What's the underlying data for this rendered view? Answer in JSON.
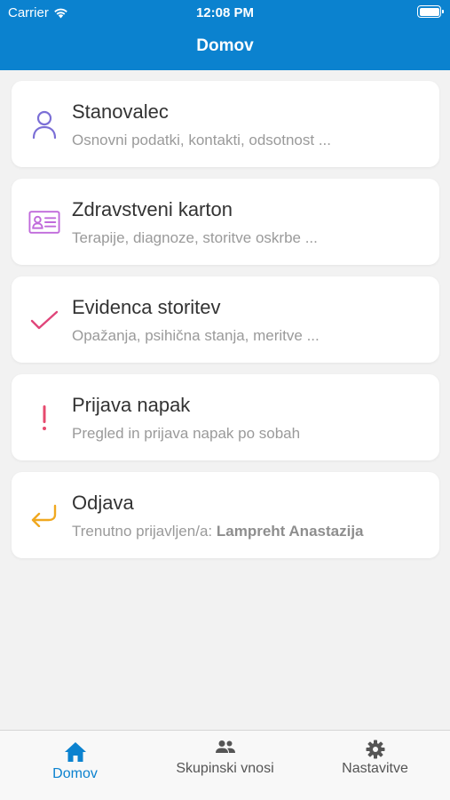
{
  "status_bar": {
    "carrier": "Carrier",
    "time": "12:08 PM"
  },
  "header": {
    "title": "Domov"
  },
  "menu": {
    "items": [
      {
        "title": "Stanovalec",
        "subtitle": "Osnovni podatki, kontakti, odsotnost ...",
        "icon": "person-icon",
        "color": "#7b6fd6"
      },
      {
        "title": "Zdravstveni karton",
        "subtitle": "Terapije, diagnoze, storitve oskrbe ...",
        "icon": "id-card-icon",
        "color": "#c06adb"
      },
      {
        "title": "Evidenca storitev",
        "subtitle": "Opažanja, psihična stanja, meritve ...",
        "icon": "checkmark-icon",
        "color": "#e0457a"
      },
      {
        "title": "Prijava napak",
        "subtitle": "Pregled in prijava napak po sobah",
        "icon": "exclamation-icon",
        "color": "#e64a6e"
      },
      {
        "title": "Odjava",
        "subtitle_prefix": "Trenutno prijavljen/a: ",
        "subtitle_user": "Lampreht Anastazija",
        "icon": "return-arrow-icon",
        "color": "#f0a820"
      }
    ]
  },
  "tabbar": {
    "tabs": [
      {
        "label": "Domov",
        "icon": "home-icon",
        "active": true
      },
      {
        "label": "Skupinski vnosi",
        "icon": "people-icon",
        "active": false
      },
      {
        "label": "Nastavitve",
        "icon": "gear-icon",
        "active": false
      }
    ]
  },
  "colors": {
    "accent": "#0b82cf",
    "background": "#f2f2f2"
  }
}
